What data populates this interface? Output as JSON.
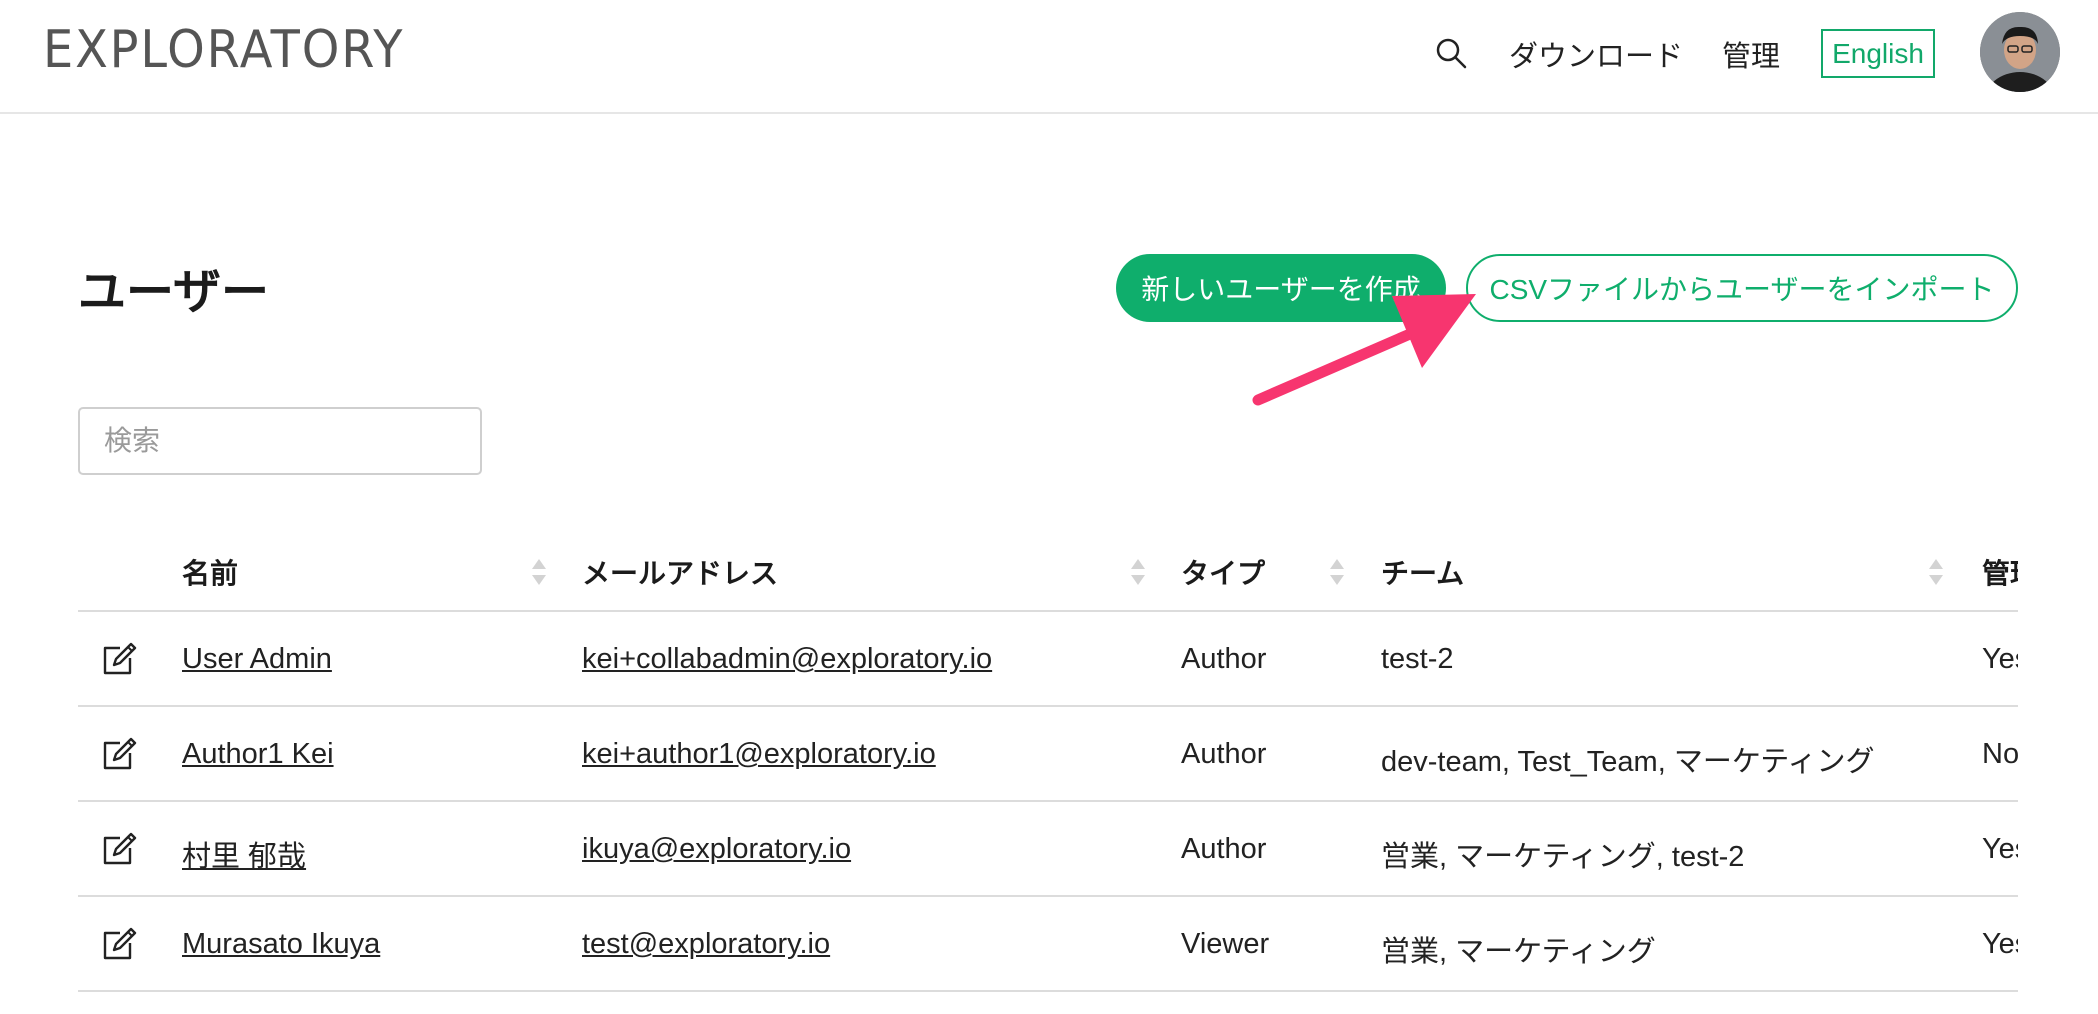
{
  "header": {
    "logo": "EXPLORATORY",
    "nav_download": "ダウンロード",
    "nav_admin": "管理",
    "lang_button": "English",
    "icons": {
      "search": "search-icon",
      "avatar": "user-avatar"
    },
    "accent_color": "#0fae6c"
  },
  "page": {
    "title": "ユーザー",
    "create_button": "新しいユーザーを作成",
    "import_button": "CSVファイルからユーザーをインポート",
    "search_placeholder": "検索",
    "annotation_arrow_color": "#f7356f"
  },
  "table": {
    "columns": [
      "名前",
      "メールアドレス",
      "タイプ",
      "チーム",
      "管理"
    ],
    "rows": [
      {
        "name": "User Admin",
        "email": "kei+collabadmin@exploratory.io",
        "type": "Author",
        "team": "test-2",
        "admin": "Yes"
      },
      {
        "name": "Author1 Kei",
        "email": "kei+author1@exploratory.io",
        "type": "Author",
        "team": "dev-team, Test_Team, マーケティング",
        "admin": "No"
      },
      {
        "name": "村里 郁哉",
        "email": "ikuya@exploratory.io",
        "type": "Author",
        "team": "営業, マーケティング, test-2",
        "admin": "Yes"
      },
      {
        "name": "Murasato Ikuya",
        "email": "test@exploratory.io",
        "type": "Viewer",
        "team": "営業, マーケティング",
        "admin": "Yes"
      }
    ]
  }
}
